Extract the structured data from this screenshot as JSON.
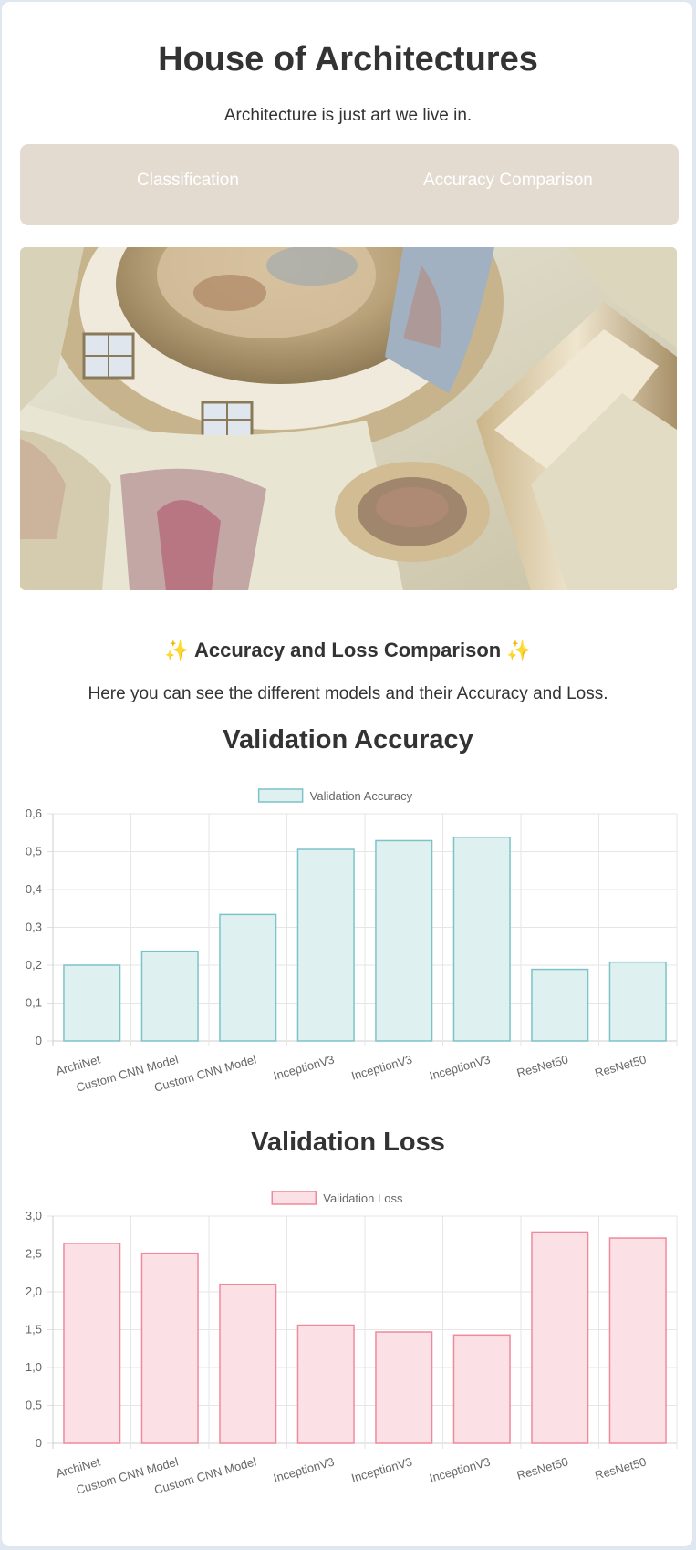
{
  "header": {
    "title": "House of Architectures",
    "tagline": "Architecture is just art we live in."
  },
  "nav": {
    "items": [
      {
        "label": "Classification"
      },
      {
        "label": "Accuracy Comparison"
      }
    ]
  },
  "section": {
    "title": "✨ Accuracy and Loss Comparison ✨",
    "description": "Here you can see the different models and their Accuracy and Loss."
  },
  "colors": {
    "nav_bg": "#e4dbd0",
    "accuracy_fill": "#dff0f0",
    "accuracy_border": "#7cc3c8",
    "loss_fill": "#fbe1e5",
    "loss_border": "#ee8a9c"
  },
  "chart_data": [
    {
      "type": "bar",
      "title": "Validation Accuracy",
      "categories": [
        "ArchiNet",
        "Custom CNN Model",
        "Custom CNN Model",
        "InceptionV3",
        "InceptionV3",
        "InceptionV3",
        "ResNet50",
        "ResNet50"
      ],
      "series": [
        {
          "name": "Validation Accuracy",
          "values": [
            0.2,
            0.237,
            0.334,
            0.506,
            0.529,
            0.538,
            0.189,
            0.208
          ]
        }
      ],
      "ylim": [
        0,
        0.6
      ],
      "yticks": [
        "0",
        "0,1",
        "0,2",
        "0,3",
        "0,4",
        "0,5",
        "0,6"
      ],
      "grid": true,
      "legend": "top-center"
    },
    {
      "type": "bar",
      "title": "Validation Loss",
      "categories": [
        "ArchiNet",
        "Custom CNN Model",
        "Custom CNN Model",
        "InceptionV3",
        "InceptionV3",
        "InceptionV3",
        "ResNet50",
        "ResNet50"
      ],
      "series": [
        {
          "name": "Validation Loss",
          "values": [
            2.64,
            2.51,
            2.1,
            1.56,
            1.47,
            1.43,
            2.79,
            2.71
          ]
        }
      ],
      "ylim": [
        0,
        3.0
      ],
      "yticks": [
        "0",
        "0,5",
        "1,0",
        "1,5",
        "2,0",
        "2,5",
        "3,0"
      ],
      "grid": true,
      "legend": "top-center"
    }
  ]
}
